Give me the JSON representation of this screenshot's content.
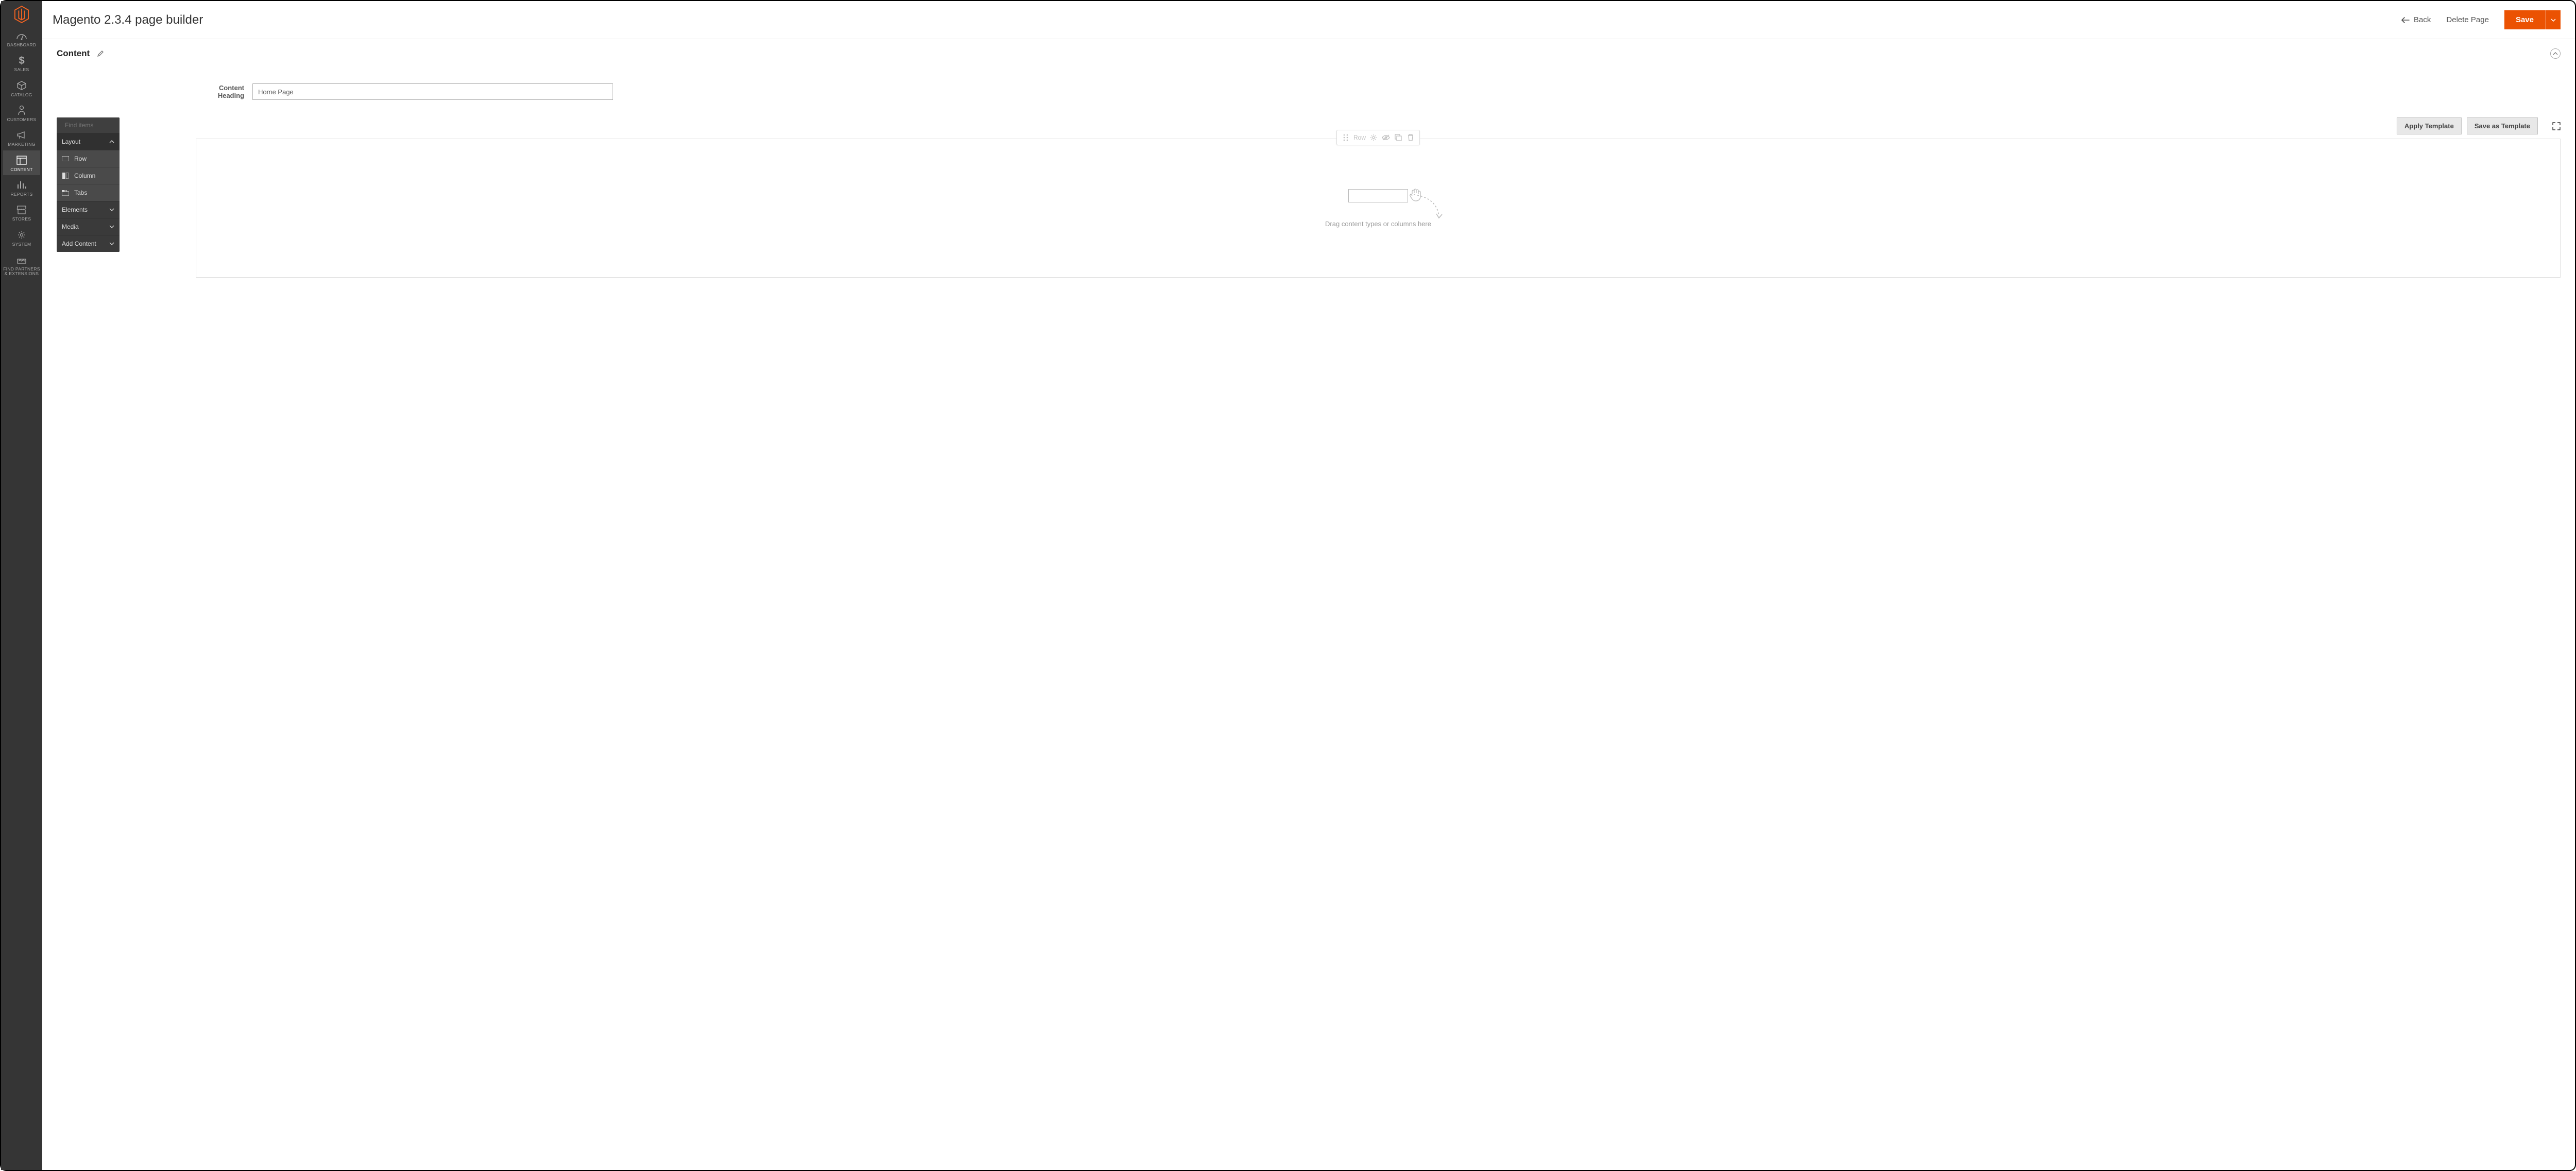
{
  "app": {
    "title": "Magento 2.3.4 page builder"
  },
  "header": {
    "back_label": "Back",
    "delete_label": "Delete Page",
    "save_label": "Save"
  },
  "sidebar": {
    "items": [
      {
        "id": "dashboard",
        "label": "DASHBOARD"
      },
      {
        "id": "sales",
        "label": "SALES"
      },
      {
        "id": "catalog",
        "label": "CATALOG"
      },
      {
        "id": "customers",
        "label": "CUSTOMERS"
      },
      {
        "id": "marketing",
        "label": "MARKETING"
      },
      {
        "id": "content",
        "label": "CONTENT"
      },
      {
        "id": "reports",
        "label": "REPORTS"
      },
      {
        "id": "stores",
        "label": "STORES"
      },
      {
        "id": "system",
        "label": "SYSTEM"
      },
      {
        "id": "partners",
        "label": "FIND PARTNERS\n& EXTENSIONS"
      }
    ],
    "active_id": "content"
  },
  "section": {
    "title": "Content"
  },
  "content_heading": {
    "label": "Content Heading",
    "value": "Home Page"
  },
  "template_buttons": {
    "apply": "Apply Template",
    "save": "Save as Template"
  },
  "palette": {
    "search_placeholder": "Find items",
    "groups": [
      {
        "id": "layout",
        "label": "Layout",
        "open": true,
        "items": [
          {
            "id": "row",
            "label": "Row"
          },
          {
            "id": "column",
            "label": "Column"
          },
          {
            "id": "tabs",
            "label": "Tabs"
          }
        ]
      },
      {
        "id": "elements",
        "label": "Elements",
        "open": false
      },
      {
        "id": "media",
        "label": "Media",
        "open": false
      },
      {
        "id": "addcontent",
        "label": "Add Content",
        "open": false
      }
    ]
  },
  "row_toolbar": {
    "label": "Row"
  },
  "canvas": {
    "placeholder": "Drag content types or columns here"
  }
}
